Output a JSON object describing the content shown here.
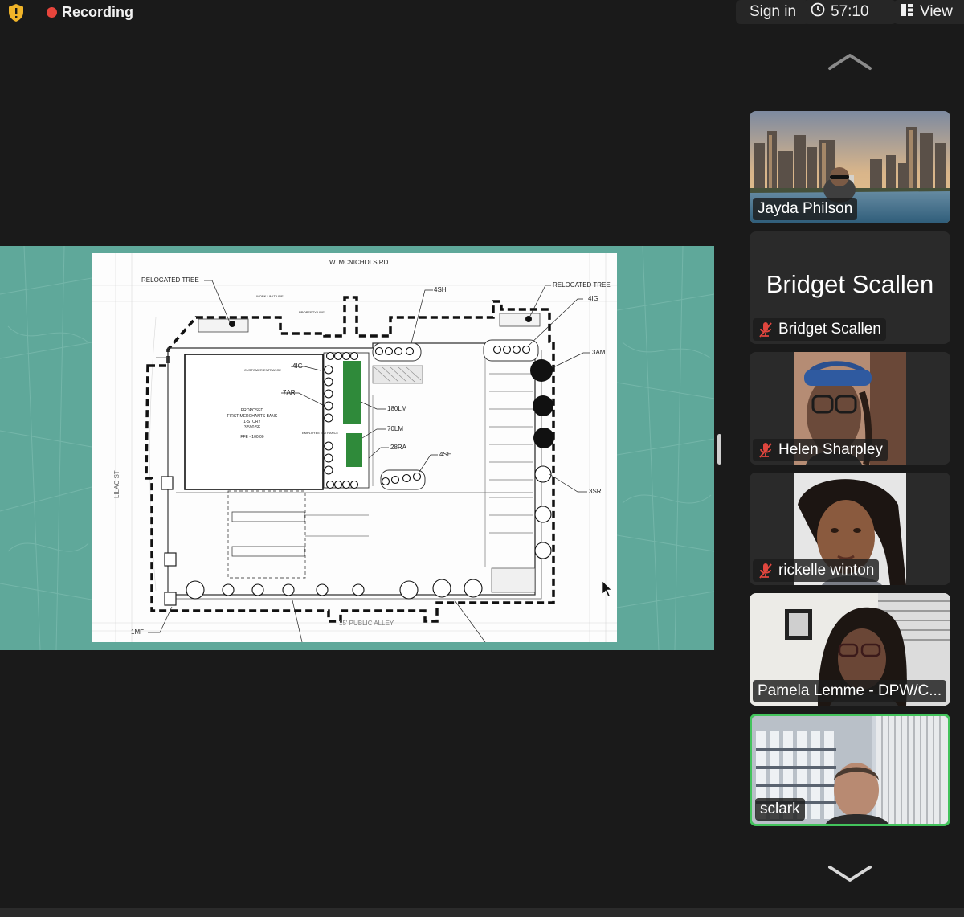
{
  "top_bar": {
    "recording_label": "Recording",
    "sign_in_label": "Sign in",
    "timer": "57:10",
    "view_label": "View"
  },
  "shared_screen": {
    "plan_labels": {
      "street_top": "W. MCNICHOLS RD.",
      "relocated_tree_left": "RELOCATED TREE",
      "relocated_tree_right": "RELOCATED TREE",
      "sh_top": "4SH",
      "ig_right": "4IG",
      "ig_left": "4IG",
      "ar": "7AR",
      "am": "3AM",
      "lm180": "180LM",
      "lm70": "70LM",
      "ra": "28RA",
      "sh_mid": "4SH",
      "sr": "3SR",
      "mf": "1MF",
      "alley": "15' PUBLIC ALLEY",
      "lilac": "LILAC ST",
      "bank_1": "PROPOSED",
      "bank_2": "FIRST MERCHANTS BANK",
      "bank_3": "1-STORY",
      "bank_4": "3,590 SF",
      "ffe": "FFE - 100.00",
      "customer_entrance": "CUSTOMER ENTRANCE",
      "employee_entrance": "EMPLOYEE ENTRANCE",
      "property_line": "PROPERTY LINE",
      "work_limit_line": "WORK LIMIT LINE"
    }
  },
  "participants": [
    {
      "name": "Jayda Philson",
      "muted": false
    },
    {
      "name": "Bridget Scallen",
      "display_name": "Bridget Scallen",
      "muted": true
    },
    {
      "name": "Helen Sharpley",
      "muted": true
    },
    {
      "name": "rickelle winton",
      "muted": true
    },
    {
      "name": "Pamela Lemme - DPW/C...",
      "muted": false
    },
    {
      "name": "sclark",
      "muted": false,
      "active_speaker": true
    }
  ],
  "colors": {
    "background": "#1a1a1a",
    "record_dot": "#e8453c",
    "active_border": "#43c35c",
    "mute_red": "#e0463e",
    "share_bg": "#5fa89a",
    "plant_green": "#2f8a3a"
  }
}
